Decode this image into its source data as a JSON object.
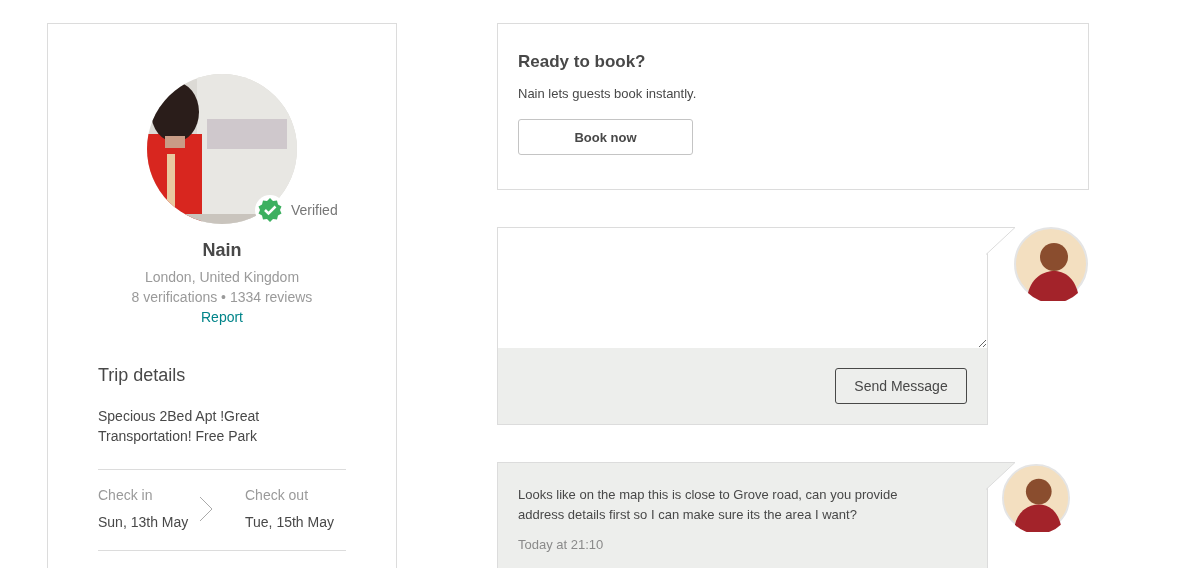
{
  "host": {
    "name": "Nain",
    "verified_label": "Verified",
    "location": "London, United Kingdom",
    "stats": "8 verifications • 1334 reviews",
    "report_link": "Report"
  },
  "trip": {
    "title": "Trip details",
    "listing": "Specious 2Bed Apt !Great Transportation! Free Park",
    "check_in": {
      "label": "Check in",
      "date": "Sun, 13th May"
    },
    "check_out": {
      "label": "Check out",
      "date": "Tue, 15th May"
    }
  },
  "booking": {
    "title": "Ready to book?",
    "text": "Nain lets guests book instantly.",
    "button": "Book now"
  },
  "composer": {
    "button": "Send Message"
  },
  "messages": [
    {
      "text": "Looks like on the map this is close to Grove road, can you provide address details first so I can make sure its the area I want?",
      "time": "Today at 21:10"
    }
  ]
}
